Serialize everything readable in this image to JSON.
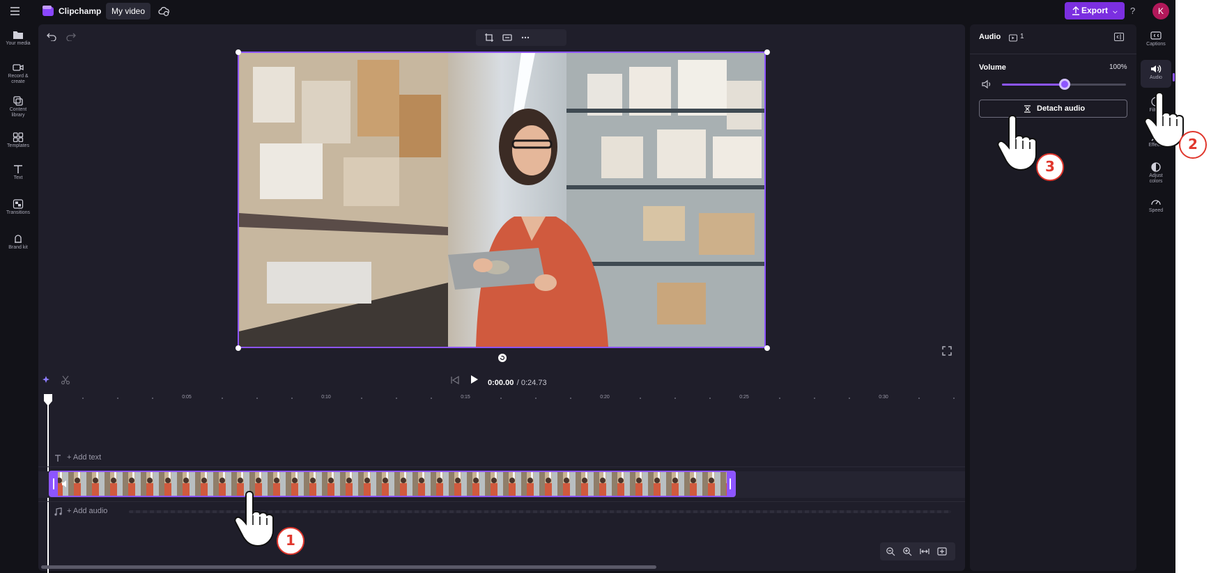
{
  "app": {
    "brand_name": "Clipchamp",
    "project_name": "My video",
    "export_label": "Export",
    "help_label": "?",
    "avatar_initial": "K",
    "accent_color": "#7b2fe0",
    "selection_color": "#8d55ff",
    "cursor_badge_color": "#e0372d"
  },
  "left_nav": {
    "items": [
      {
        "label": "Your media",
        "icon": "folder-icon"
      },
      {
        "label": "Record & create",
        "icon": "video-camera-icon"
      },
      {
        "label": "Content library",
        "icon": "library-icon"
      },
      {
        "label": "Templates",
        "icon": "templates-icon"
      },
      {
        "label": "Text",
        "icon": "text-icon"
      },
      {
        "label": "Transitions",
        "icon": "transitions-icon"
      },
      {
        "label": "Brand kit",
        "icon": "brand-kit-icon"
      }
    ]
  },
  "player": {
    "current_time": "0:00.00",
    "total_time": "/ 0:24.73"
  },
  "timeline": {
    "ticks": [
      "0:05",
      "0:10",
      "0:15",
      "0:20",
      "0:25",
      "0:30"
    ],
    "add_text_label": "+ Add text",
    "add_audio_label": "+ Add audio"
  },
  "audio_panel": {
    "title": "Audio",
    "clip_count": "1",
    "volume_label": "Volume",
    "volume_value": "100%",
    "volume_level_fraction": 0.5,
    "detach_label": "Detach audio"
  },
  "right_nav": {
    "items": [
      {
        "label": "Captions",
        "icon": "captions-icon"
      },
      {
        "label": "Audio",
        "icon": "speaker-icon"
      },
      {
        "label": "Filters",
        "icon": "filters-icon"
      },
      {
        "label": "Effects",
        "icon": "magic-wand-icon"
      },
      {
        "label": "Adjust colors",
        "icon": "contrast-icon"
      },
      {
        "label": "Speed",
        "icon": "speedometer-icon"
      }
    ]
  },
  "annotations": {
    "step_1": "1",
    "step_2": "2",
    "step_3": "3"
  }
}
